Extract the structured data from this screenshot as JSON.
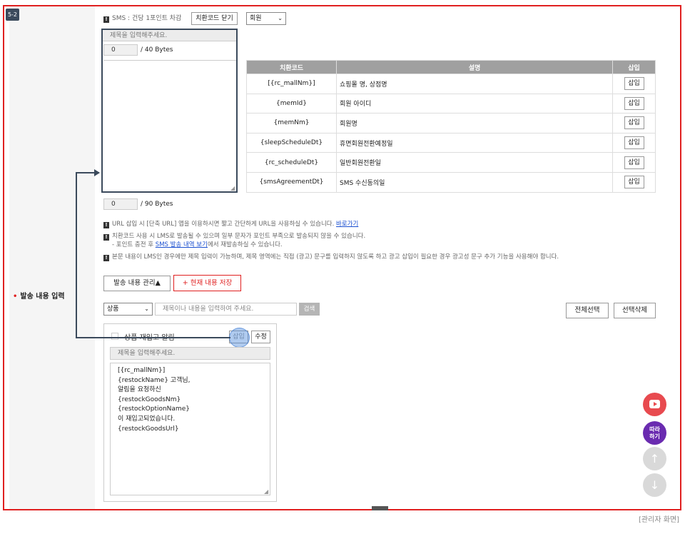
{
  "step_badge": "5-2",
  "section_label": "발송 내용 입력",
  "sms_notice": "SMS : 건당 1포인트 차감",
  "close_code_button": "치환코드 닫기",
  "member_select": "회원",
  "title_placeholder": "제목을 입력해주세요.",
  "title_counter": "0",
  "title_limit": "/ 40 Bytes",
  "body_counter": "0",
  "body_limit": "/ 90 Bytes",
  "code_table": {
    "headers": [
      "치환코드",
      "설명",
      "삽입"
    ],
    "rows": [
      {
        "code": "[{rc_mallNm}]",
        "desc": "쇼핑몰 명, 상점명",
        "action": "삽입"
      },
      {
        "code": "{memId}",
        "desc": "회원 아이디",
        "action": "삽입"
      },
      {
        "code": "{memNm}",
        "desc": "회원명",
        "action": "삽입"
      },
      {
        "code": "{sleepScheduleDt}",
        "desc": "휴면회원전환예정일",
        "action": "삽입"
      },
      {
        "code": "{rc_scheduleDt}",
        "desc": "일반회원전환일",
        "action": "삽입"
      },
      {
        "code": "{smsAgreementDt}",
        "desc": "SMS 수신동의일",
        "action": "삽입"
      }
    ]
  },
  "notes": {
    "url_note": "URL 삽입 시 [단축 URL] 앱을 이용하시면 짧고 간단하게 URL을 사용하실 수 있습니다.",
    "url_link": "바로가기",
    "lms_note": "치환코드 사용 시 LMS로 발송될 수 있으며 일부 문자가 포인트 부족으로 발송되지 않을 수 있습니다.",
    "charge_prefix": "- 포인트 충전 후 ",
    "charge_link": "SMS 발송 내역 보기",
    "charge_suffix": "에서 재발송하실 수 있습니다.",
    "title_note": "본문 내용이 LMS인 경우에만 제목 입력이 가능하며, 제목 영역에는 직접 (광고) 문구를 입력하지 않도록 하고 광고 삽입이 필요한 경우 광고성 문구 추가 기능을 사용해야 합니다."
  },
  "manage_button": "발송 내용 관리▲",
  "save_button": "+ 현재 내용 저장",
  "filter_select": "상품",
  "search_placeholder": "제목이나 내용을 입력하여 주세요.",
  "search_button": "검색",
  "select_all_button": "전체선택",
  "delete_selected_button": "선택삭제",
  "card": {
    "title": "상품 재입고 알림",
    "insert_button": "삽입",
    "edit_button": "수정",
    "title_placeholder": "제목을 입력해주세요.",
    "body": "[{rc_mallNm}]\n{restockName} 고객님,\n알림을 요청하신\n{restockGoodsNm}\n{restockOptionName}\n이 재입고되었습니다.\n{restockGoodsUrl}"
  },
  "fab": {
    "follow_label": "따라\n하기",
    "up_icon": "↑",
    "down_icon": "↓"
  },
  "caption": "[관리자 화면]",
  "colors": {
    "accent_red": "#e02020",
    "editor_border": "#3b4a5c",
    "table_header": "#a0a0a0",
    "youtube": "#e84a4f",
    "follow": "#6a2bb0"
  }
}
